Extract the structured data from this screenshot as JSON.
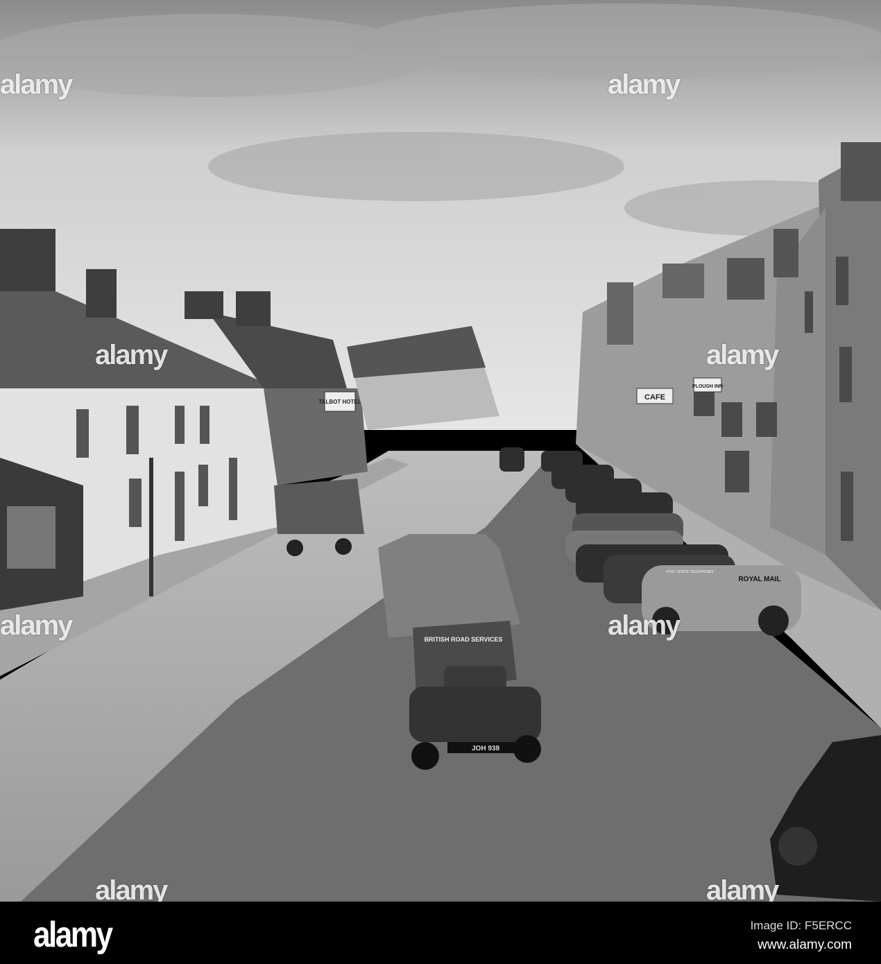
{
  "watermark": "alamy",
  "footer": {
    "logo": "alamy",
    "image_id": "Image ID: F5ERCC",
    "website": "www.alamy.com"
  },
  "scene_signs": {
    "hotel": "TALBOT HOTEL",
    "cafe": "CAFE",
    "inn": "PLOUGH INN",
    "van": "ROYAL MAIL",
    "truck": "BRITISH ROAD SERVICES",
    "plate": "JOH 938",
    "telephones": "POST OFFICE TELEPHONES"
  }
}
